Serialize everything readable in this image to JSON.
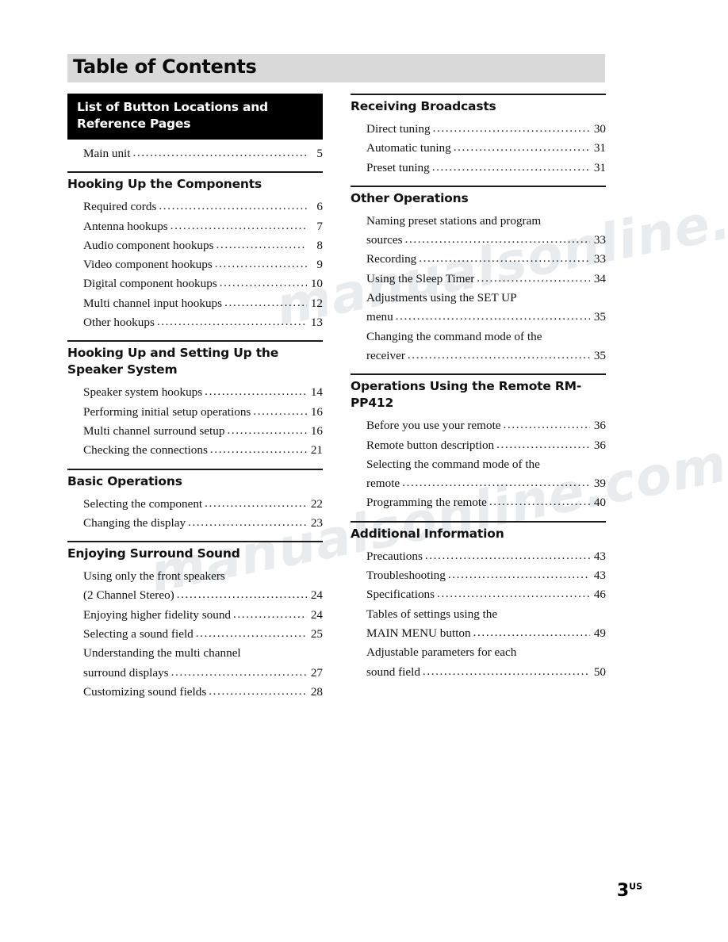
{
  "document": {
    "title": "Table of Contents",
    "page_number": "3",
    "page_suffix": "US",
    "watermark_line1": "manualsonline.com",
    "watermark_line2": "manualsonline.com"
  },
  "left_column": [
    {
      "heading": "List of Button Locations and Reference Pages",
      "heading_style": "inverted",
      "rule": "none",
      "entries": [
        {
          "text": "Main unit",
          "page": "5",
          "indent": "deep"
        }
      ]
    },
    {
      "heading": "Hooking Up the Components",
      "heading_style": "plain",
      "rule": "thick",
      "entries": [
        {
          "text": "Required cords",
          "page": "6"
        },
        {
          "text": "Antenna hookups",
          "page": "7"
        },
        {
          "text": "Audio component hookups",
          "page": "8"
        },
        {
          "text": "Video component hookups",
          "page": "9"
        },
        {
          "text": "Digital component hookups",
          "page": "10"
        },
        {
          "text": "Multi channel input hookups",
          "page": "12"
        },
        {
          "text": "Other hookups",
          "page": "13"
        }
      ]
    },
    {
      "heading": "Hooking Up and Setting Up the Speaker System",
      "heading_style": "plain",
      "rule": "thick",
      "entries": [
        {
          "text": "Speaker system hookups",
          "page": "14"
        },
        {
          "text": "Performing initial setup operations",
          "page": "16"
        },
        {
          "text": "Multi channel surround setup",
          "page": "16"
        },
        {
          "text": "Checking the connections",
          "page": "21"
        }
      ]
    },
    {
      "heading": "Basic Operations",
      "heading_style": "plain",
      "rule": "thick",
      "entries": [
        {
          "text": "Selecting the component",
          "page": "22"
        },
        {
          "text": "Changing the display",
          "page": "23"
        }
      ]
    },
    {
      "heading": "Enjoying Surround Sound",
      "heading_style": "plain",
      "rule": "thick",
      "entries": [
        {
          "text": "Using only the front speakers",
          "page": "",
          "nodots": true
        },
        {
          "text": "(2 Channel Stereo)",
          "page": "24",
          "continuation": true
        },
        {
          "text": "Enjoying higher fidelity sound",
          "page": "24"
        },
        {
          "text": "Selecting a sound field",
          "page": "25"
        },
        {
          "text": "Understanding the multi channel",
          "page": "",
          "nodots": true
        },
        {
          "text": "surround displays",
          "page": "27",
          "continuation": true
        },
        {
          "text": "Customizing sound fields",
          "page": "28"
        }
      ]
    }
  ],
  "right_column": [
    {
      "heading": "Receiving Broadcasts",
      "heading_style": "plain",
      "rule": "thick",
      "entries": [
        {
          "text": "Direct tuning",
          "page": "30"
        },
        {
          "text": "Automatic tuning",
          "page": "31"
        },
        {
          "text": "Preset tuning",
          "page": "31"
        }
      ]
    },
    {
      "heading": "Other Operations",
      "heading_style": "plain",
      "rule": "thick",
      "entries": [
        {
          "text": "Naming preset stations and program",
          "page": "",
          "nodots": true
        },
        {
          "text": "sources",
          "page": "33",
          "continuation": true
        },
        {
          "text": "Recording",
          "page": "33"
        },
        {
          "text": "Using the Sleep Timer",
          "page": "34"
        },
        {
          "text": "Adjustments using the SET UP",
          "page": "",
          "nodots": true
        },
        {
          "text": "menu",
          "page": "35",
          "continuation": true
        },
        {
          "text": "Changing the command mode of the",
          "page": "",
          "nodots": true
        },
        {
          "text": "receiver",
          "page": "35",
          "continuation": true
        }
      ]
    },
    {
      "heading": "Operations Using the Remote RM-PP412",
      "heading_style": "plain",
      "rule": "thick",
      "entries": [
        {
          "text": "Before you use your remote",
          "page": "36"
        },
        {
          "text": "Remote button description",
          "page": "36"
        },
        {
          "text": "Selecting the command mode of the",
          "page": "",
          "nodots": true
        },
        {
          "text": "remote",
          "page": "39",
          "continuation": true
        },
        {
          "text": "Programming the remote",
          "page": "40"
        }
      ]
    },
    {
      "heading": "Additional Information",
      "heading_style": "plain",
      "rule": "thick",
      "entries": [
        {
          "text": "Precautions",
          "page": "43"
        },
        {
          "text": "Troubleshooting",
          "page": "43"
        },
        {
          "text": "Specifications",
          "page": "46"
        },
        {
          "text": "Tables of settings using the",
          "page": "",
          "nodots": true
        },
        {
          "text": "MAIN MENU button",
          "page": "49",
          "continuation": true
        },
        {
          "text": "Adjustable parameters for each",
          "page": "",
          "nodots": true
        },
        {
          "text": "sound field",
          "page": "50",
          "continuation": true
        }
      ]
    }
  ]
}
